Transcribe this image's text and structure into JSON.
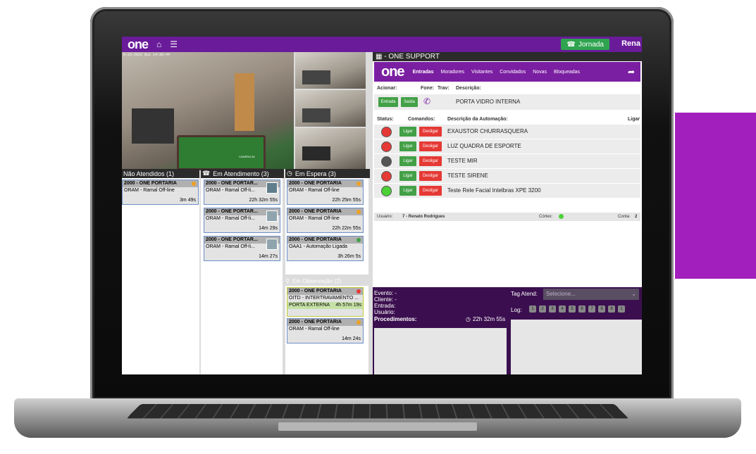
{
  "topbar": {
    "logo": "one",
    "home_icon": "home-icon",
    "menu_icon": "menu-icon",
    "jornada_label": "Jornada",
    "user_name": "Rena"
  },
  "camera": {
    "timestamp": "0-23-2023 Qui 14:30:44",
    "main_label": "CAMERA 06"
  },
  "queues": {
    "nao_atendidos": {
      "title": "Não Atendidos (1)",
      "cards": [
        {
          "title": "2000 - ONE PORTARIA",
          "line": "ORAM - Ramal Off-line",
          "time": "3m 49s",
          "status_color": "#f0a020"
        }
      ]
    },
    "em_atendimento": {
      "title": "Em Atendimento (3)",
      "cards": [
        {
          "title": "2000 - ONE PORTAR...",
          "line": "ORAM - Ramal Off-li...",
          "time": "22h 32m 55s"
        },
        {
          "title": "2000 - ONE PORTAR...",
          "line": "ORAM - Ramal Off-li...",
          "time": "14m 29s"
        },
        {
          "title": "2000 - ONE PORTAR...",
          "line": "ORAM - Ramal Off-li...",
          "time": "14m 27s"
        }
      ]
    },
    "em_espera": {
      "title": "Em Espera (3)",
      "cards": [
        {
          "title": "2000 - ONE PORTARIA",
          "line": "ORAM - Ramal Off-line",
          "time": "22h 25m 55s",
          "status_color": "#f0a020"
        },
        {
          "title": "2000 - ONE PORTARIA",
          "line": "ORAM - Ramal Off-line",
          "time": "22h 22m 55s",
          "status_color": "#f0a020"
        },
        {
          "title": "2000 - ONE PORTARIA",
          "line": "OAA1 - Automação Ligada",
          "time": "3h 26m 5s",
          "status_color": "#43a047"
        }
      ]
    },
    "em_observacao": {
      "title": "Em Observação (2)",
      "cards": [
        {
          "title": "2000 - ONE PORTARIA",
          "line": "OITD - INTERTRAVAMENTO ...",
          "line2": "PORTA EXTERNA",
          "time": "4h 57m 19s",
          "status_color": "#e53935"
        },
        {
          "title": "2000 - ONE PORTARIA",
          "line": "ORAM - Ramal Off-line",
          "time": "14m 24s",
          "status_color": "#f0a020"
        }
      ]
    }
  },
  "support": {
    "title": "- ONE SUPPORT",
    "logo": "one",
    "tabs": [
      "Entradas",
      "Moradores",
      "Visitantes",
      "Convidados",
      "Novas",
      "Bloqueadas"
    ],
    "acionar_header": "Acionar:",
    "fone_header": "Fone:",
    "trav_header": "Trav:",
    "descricao_header": "Descrição:",
    "entrada_btn": "Entrada",
    "saida_btn": "Saída",
    "porta_desc": "PORTA VIDRO INTERNA",
    "status_header": "Status:",
    "comandos_header": "Comandos:",
    "desc_auto_header": "Descrição da Automação:",
    "ligar_header": "Ligar",
    "ligar_btn": "Ligar",
    "desligar_btn": "Desligar",
    "automations": [
      {
        "desc": "EXAUSTOR CHURRASQUERA",
        "status_color": "#e53935"
      },
      {
        "desc": "LUZ QUADRA DE ESPORTE",
        "status_color": "#e53935"
      },
      {
        "desc": "TESTE MIR",
        "status_color": "#555555"
      },
      {
        "desc": "TESTE SIRENE",
        "status_color": "#e53935"
      },
      {
        "desc": "Teste Rele Facial Intelbras XPE 3200",
        "status_color": "#4cd137"
      }
    ],
    "usuario_label": "Usuário:",
    "usuario_value": "7 - Renato Rodrigues",
    "cortex_label": "Córtex:",
    "conta_label": "Conta:",
    "conta_value": "2"
  },
  "bottom": {
    "evento": "Evento:  -",
    "cliente": "Cliente:  -",
    "entrada": "Entrada:",
    "usuario": "Usuário:",
    "procedimentos": "Procedimentos:",
    "timer": "22h 32m 55s",
    "tag_label": "Tag Atend:",
    "tag_placeholder": "Selecione...",
    "log_label": "Log:",
    "log_numbers": [
      "1",
      "2",
      "3",
      "4",
      "5",
      "6",
      "7",
      "8",
      "9",
      "1"
    ]
  },
  "colors": {
    "purple_bar": "#6a1b9a",
    "accent_block": "#a21fbd",
    "green": "#43a047",
    "red": "#e53935"
  }
}
